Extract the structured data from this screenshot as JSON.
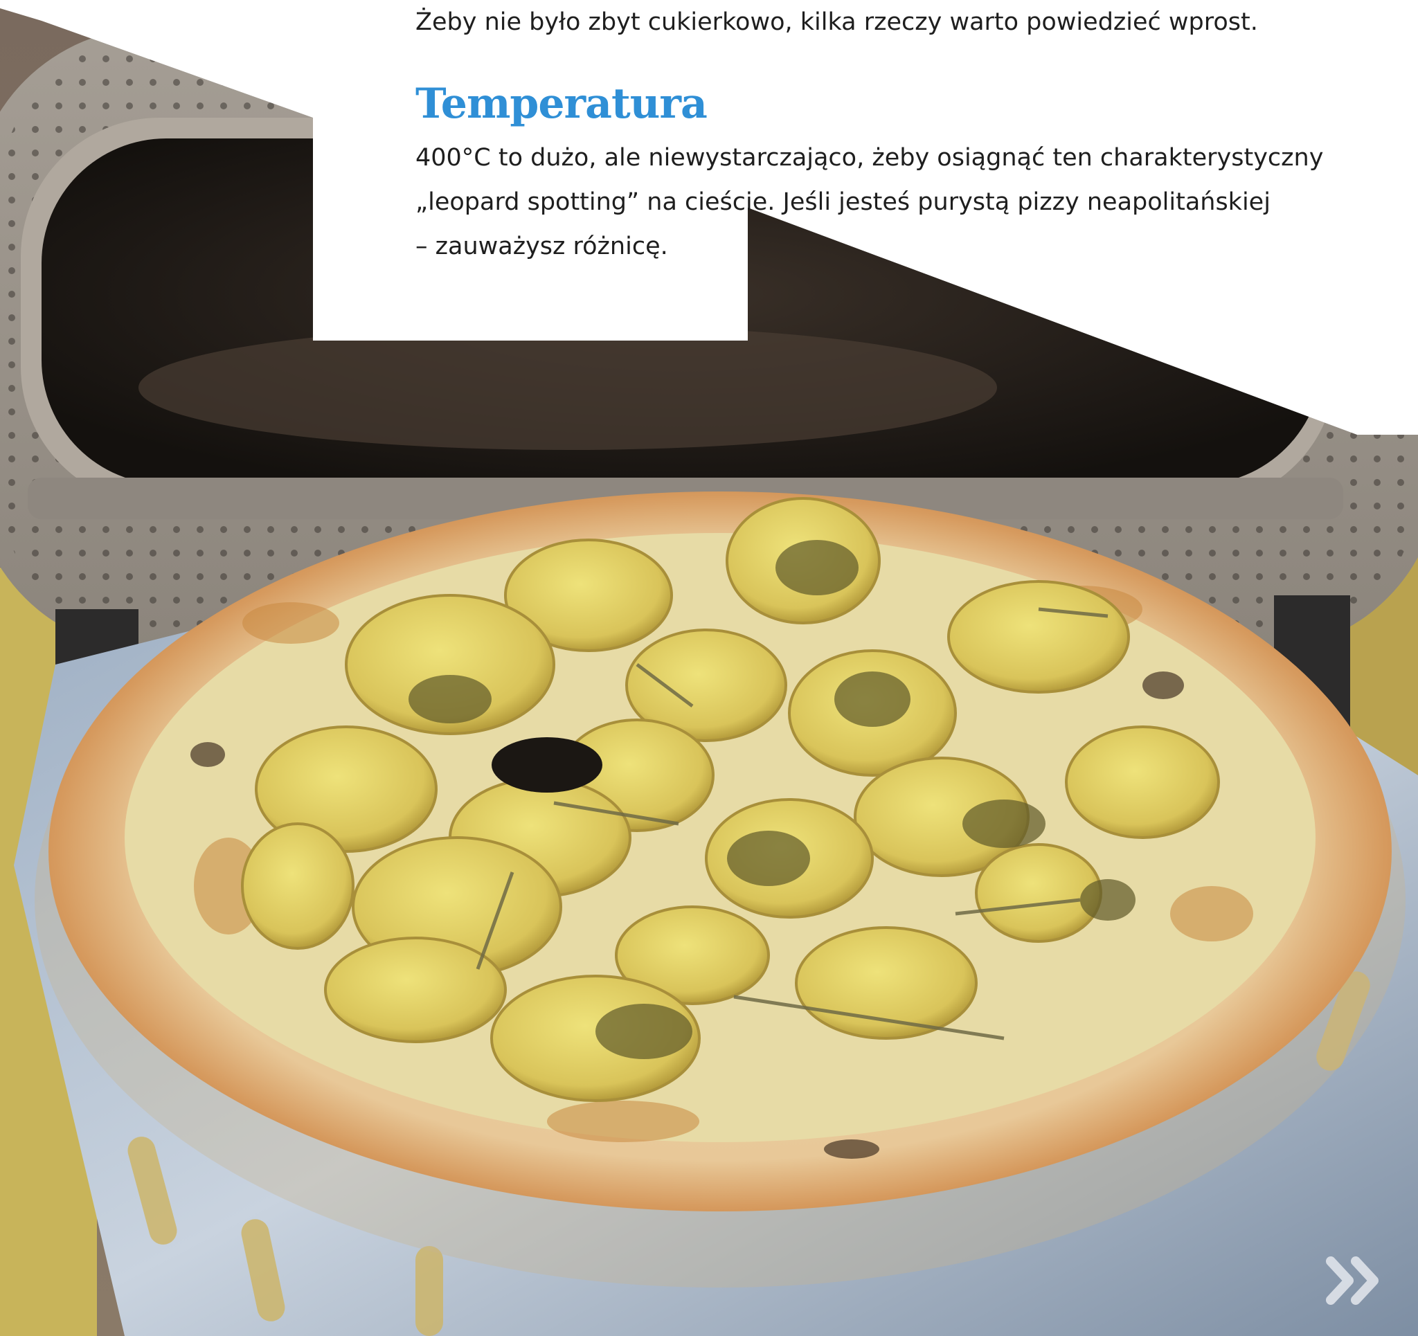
{
  "article": {
    "intro": "Żeby nie było zbyt cukierkowo, kilka rzeczy warto powiedzieć wprost.",
    "heading": "Temperatura",
    "body_lines": [
      "400°C to dużo, ale niewystarczająco, żeby osiągnąć ten charakterystyczny",
      "„leopard spotting” na cieście. Jeśli jesteś purystą pizzy neapolitańskiej",
      "– zauważysz różnicę."
    ]
  },
  "photo": {
    "subject": "pizza with potatoes and rosemary on a pizza peel in front of an oven"
  },
  "navigation": {
    "next_icon": "double-chevron-right-icon"
  },
  "colors": {
    "heading": "#2f8fd6",
    "text": "#1e1e1e",
    "band": "#ffffff"
  }
}
